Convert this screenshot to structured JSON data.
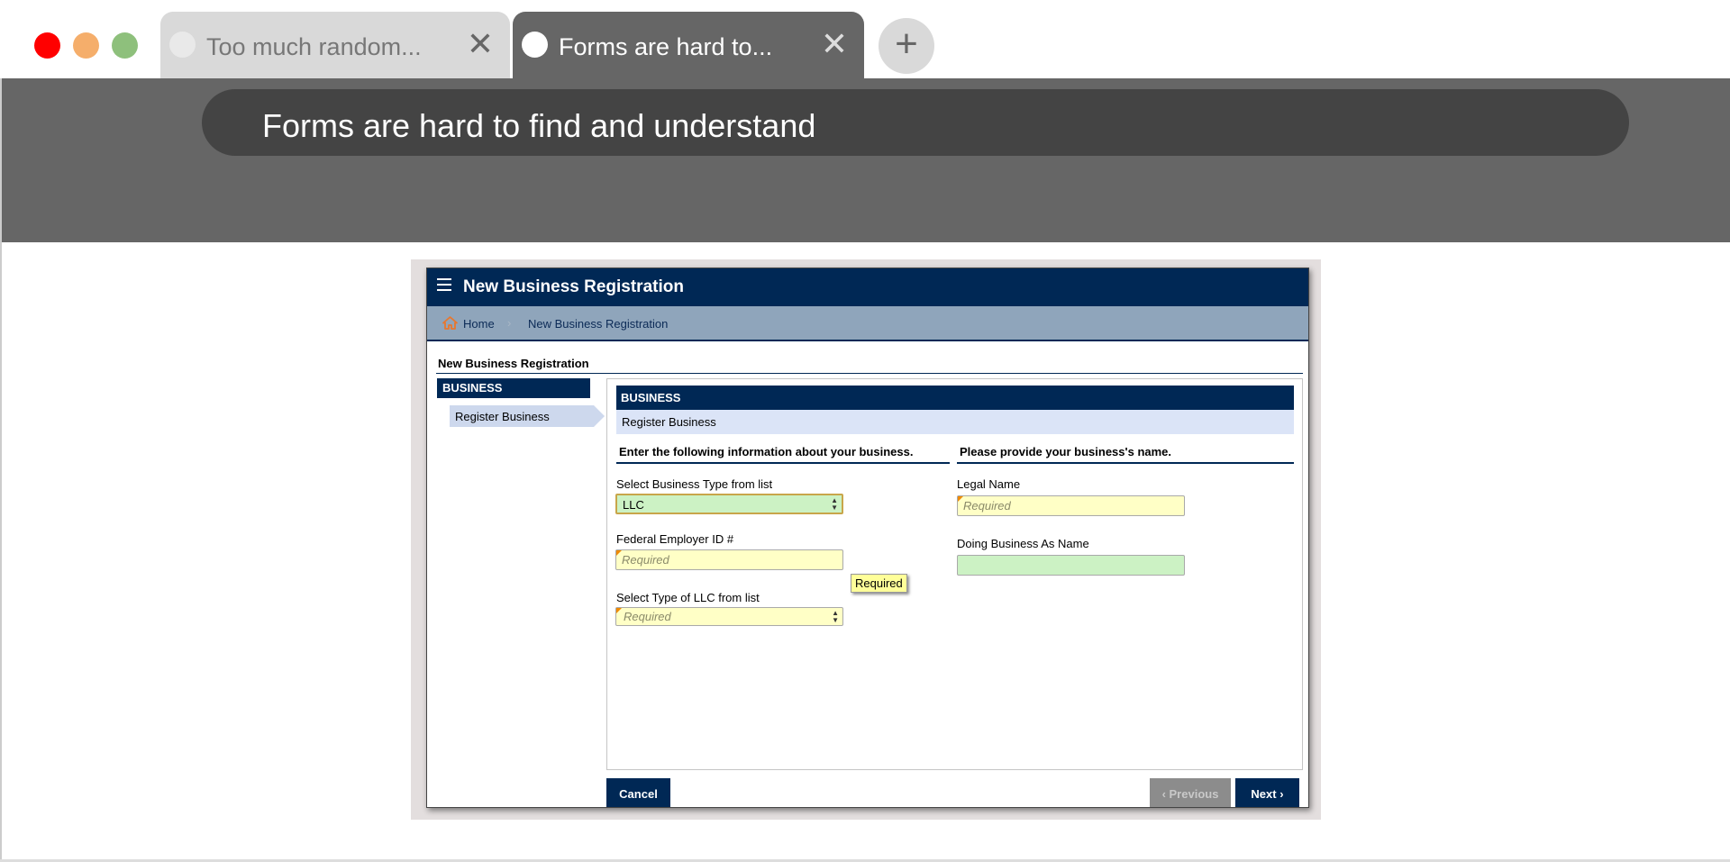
{
  "browser": {
    "tabs": [
      {
        "title": "Too much random...",
        "active": false
      },
      {
        "title": "Forms are hard to...",
        "active": true
      }
    ],
    "close_glyph": "✕",
    "new_tab_glyph": "+",
    "address": "Forms are hard to find and understand",
    "colors": {
      "close": "#ff0000",
      "minimize": "#f5ae6b",
      "maximize": "#8ec07c",
      "toolbar": "#666666"
    }
  },
  "app": {
    "title": "New Business Registration",
    "breadcrumb": {
      "home": "Home",
      "separator": "›",
      "current": "New Business Registration"
    },
    "page_heading": "New Business Registration",
    "sidebar": {
      "section": "BUSINESS",
      "steps": [
        {
          "label": "Register Business",
          "active": true
        }
      ]
    },
    "form": {
      "section_title": "BUSINESS",
      "section_subtitle": "Register Business",
      "left_column_heading": "Enter the following information about your business.",
      "right_column_heading": "Please provide your business's name.",
      "fields": {
        "business_type": {
          "label": "Select Business Type from list",
          "value": "LLC"
        },
        "fein": {
          "label": "Federal Employer ID #",
          "placeholder": "Required",
          "tooltip": "Required"
        },
        "llc_type": {
          "label": "Select Type of LLC from list",
          "placeholder": "Required"
        },
        "legal_name": {
          "label": "Legal Name",
          "placeholder": "Required"
        },
        "dba_name": {
          "label": "Doing Business As Name",
          "value": ""
        }
      }
    },
    "buttons": {
      "cancel": "Cancel",
      "previous": "Previous",
      "next": "Next"
    },
    "colors": {
      "primary": "#002855",
      "required_field": "#ffffc6",
      "valid_field": "#ccf2c4",
      "tooltip": "#ffff99"
    }
  }
}
